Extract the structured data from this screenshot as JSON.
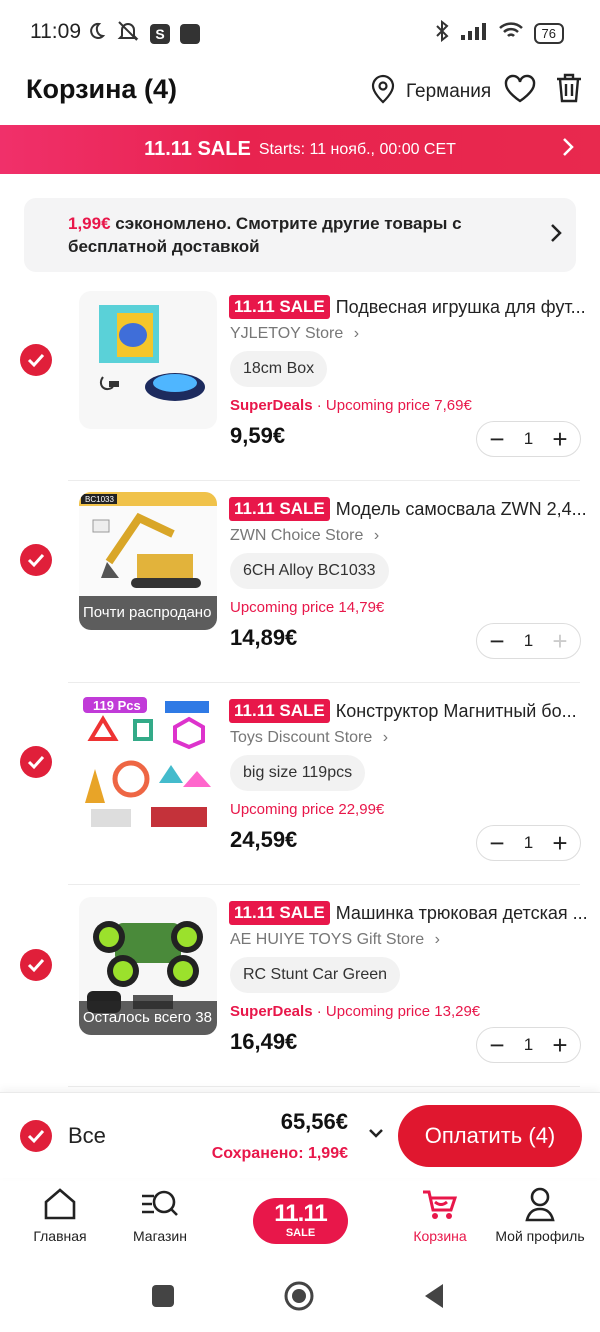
{
  "status_bar": {
    "time": "11:09",
    "battery": "76"
  },
  "header": {
    "title": "Корзина (4)",
    "location": "Германия"
  },
  "sale_banner": {
    "title": "11.11 SALE",
    "subtitle": "Starts: 11 нояб., 00:00 CET"
  },
  "notice": {
    "amount": "1,99€",
    "text": " сэкономлено. Смотрите другие товары с бесплатной доставкой"
  },
  "items": [
    {
      "tag": "11.11 SALE",
      "title": "Подвесная игрушка для фут...",
      "store": "YJLETOY Store",
      "variant": "18cm Box",
      "promo_brand": "SuperDeals",
      "promo_sep": " · ",
      "promo": "Upcoming price 7,69€",
      "price": "9,59€",
      "quantity": "1",
      "overlay": ""
    },
    {
      "tag": "11.11 SALE",
      "title": "Модель самосвала ZWN 2,4...",
      "store": "ZWN Choice Store",
      "variant": "6CH Alloy BC1033",
      "promo_brand": "",
      "promo_sep": "",
      "promo": "Upcoming price 14,79€",
      "price": "14,89€",
      "quantity": "1",
      "overlay": "Почти распродано",
      "image_label": "BC1033"
    },
    {
      "tag": "11.11 SALE",
      "title": "Конструктор Магнитный бо...",
      "store": "Toys Discount Store",
      "variant": "big size 119pcs",
      "promo_brand": "",
      "promo_sep": "",
      "promo": "Upcoming price 22,99€",
      "price": "24,59€",
      "quantity": "1",
      "overlay": "",
      "image_label": "119 Pcs"
    },
    {
      "tag": "11.11 SALE",
      "title": "Машинка трюковая детская ...",
      "store": "AE HUIYE TOYS Gift Store",
      "variant": "RC Stunt Car Green",
      "promo_brand": "SuperDeals",
      "promo_sep": " · ",
      "promo": "Upcoming price 13,29€",
      "price": "16,49€",
      "quantity": "1",
      "overlay": "Осталось всего 38"
    }
  ],
  "checkout": {
    "all_label": "Все",
    "total": "65,56€",
    "saved": "Сохранено: 1,99€",
    "pay_label": "Оплатить (4)"
  },
  "bottom_nav": [
    {
      "label": "Главная",
      "icon": "home-icon"
    },
    {
      "label": "Магазин",
      "icon": "store-search-icon"
    },
    {
      "label": "11.11 SALE",
      "icon": "sale-badge"
    },
    {
      "label": "Корзина",
      "icon": "cart-icon"
    },
    {
      "label": "Мой профиль",
      "icon": "profile-icon"
    }
  ],
  "sale_badge": {
    "top": "11.11",
    "bottom": "SALE"
  },
  "colors": {
    "accent": "#e8174a",
    "check": "#e01f3a",
    "pay": "#e0172f"
  }
}
